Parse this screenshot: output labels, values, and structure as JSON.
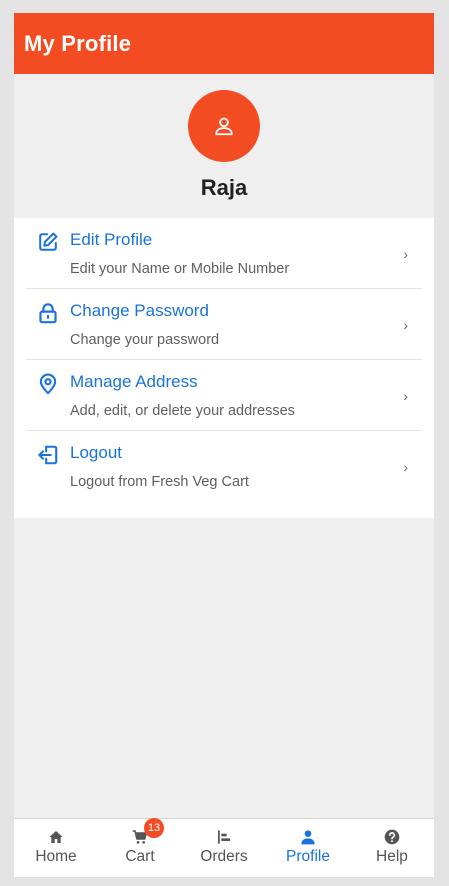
{
  "app_bar": {
    "title": "My Profile"
  },
  "profile": {
    "avatar_icon": "person-outline-icon",
    "name": "Raja"
  },
  "menu": {
    "items": [
      {
        "title": "Edit Profile",
        "subtitle": "Edit your Name or Mobile Number",
        "icon": "edit-icon"
      },
      {
        "title": "Change Password",
        "subtitle": "Change your password",
        "icon": "lock-icon"
      },
      {
        "title": "Manage Address",
        "subtitle": "Add, edit, or delete your addresses",
        "icon": "location-pin-icon"
      },
      {
        "title": "Logout",
        "subtitle": "Logout from Fresh Veg Cart",
        "icon": "logout-icon"
      }
    ],
    "chevron": "›"
  },
  "bottom_nav": {
    "items": [
      {
        "label": "Home",
        "icon": "home-icon"
      },
      {
        "label": "Cart",
        "icon": "cart-icon",
        "badge": "13"
      },
      {
        "label": "Orders",
        "icon": "orders-icon"
      },
      {
        "label": "Profile",
        "icon": "person-icon",
        "active": true
      },
      {
        "label": "Help",
        "icon": "help-icon"
      }
    ]
  },
  "colors": {
    "brand": "#f34b22",
    "link": "#1a73d9"
  }
}
